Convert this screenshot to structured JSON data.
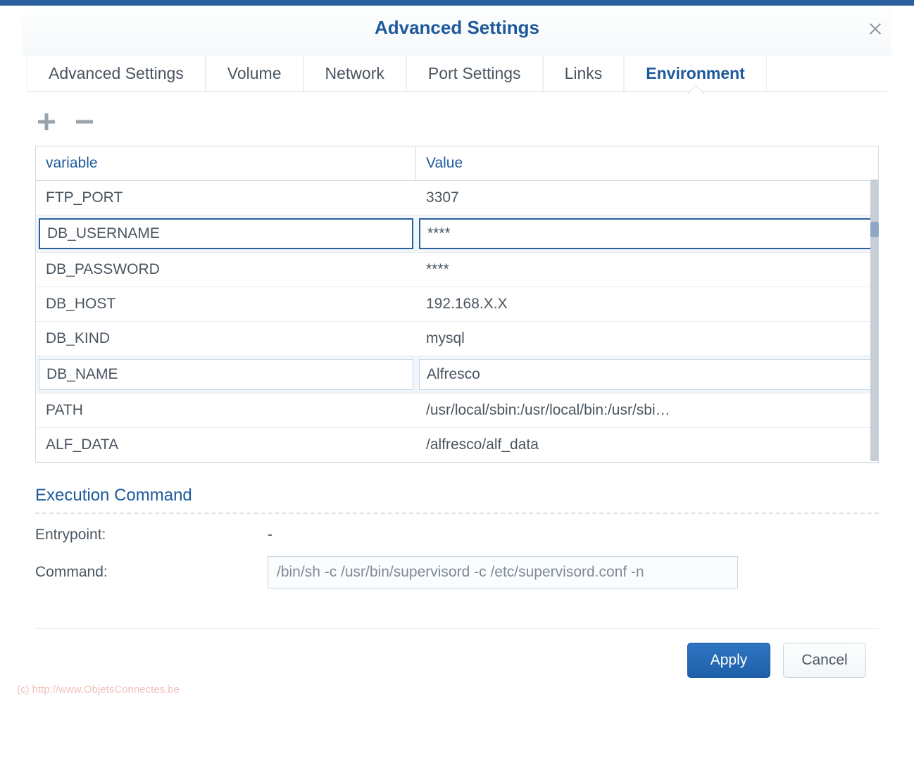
{
  "dialog": {
    "title": "Advanced Settings"
  },
  "tabs": [
    {
      "label": "Advanced Settings",
      "active": false
    },
    {
      "label": "Volume",
      "active": false
    },
    {
      "label": "Network",
      "active": false
    },
    {
      "label": "Port Settings",
      "active": false
    },
    {
      "label": "Links",
      "active": false
    },
    {
      "label": "Environment",
      "active": true
    }
  ],
  "table": {
    "columns": {
      "variable": "variable",
      "value": "Value"
    },
    "rows": [
      {
        "variable": "FTP_PORT",
        "value": "3307",
        "state": "normal"
      },
      {
        "variable": "DB_USERNAME",
        "value": "****",
        "state": "selected"
      },
      {
        "variable": "DB_PASSWORD",
        "value": "****",
        "state": "normal"
      },
      {
        "variable": "DB_HOST",
        "value": "192.168.X.X",
        "state": "normal"
      },
      {
        "variable": "DB_KIND",
        "value": "mysql",
        "state": "normal"
      },
      {
        "variable": "DB_NAME",
        "value": "Alfresco",
        "state": "editable"
      },
      {
        "variable": "PATH",
        "value": "/usr/local/sbin:/usr/local/bin:/usr/sbi…",
        "state": "normal"
      },
      {
        "variable": "ALF_DATA",
        "value": "/alfresco/alf_data",
        "state": "normal"
      }
    ]
  },
  "execution": {
    "heading": "Execution Command",
    "entrypoint_label": "Entrypoint:",
    "entrypoint_value": "-",
    "command_label": "Command:",
    "command_value": "/bin/sh -c /usr/bin/supervisord -c /etc/supervisord.conf -n"
  },
  "buttons": {
    "apply": "Apply",
    "cancel": "Cancel"
  },
  "watermark": "(c) http://www.ObjetsConnectes.be"
}
